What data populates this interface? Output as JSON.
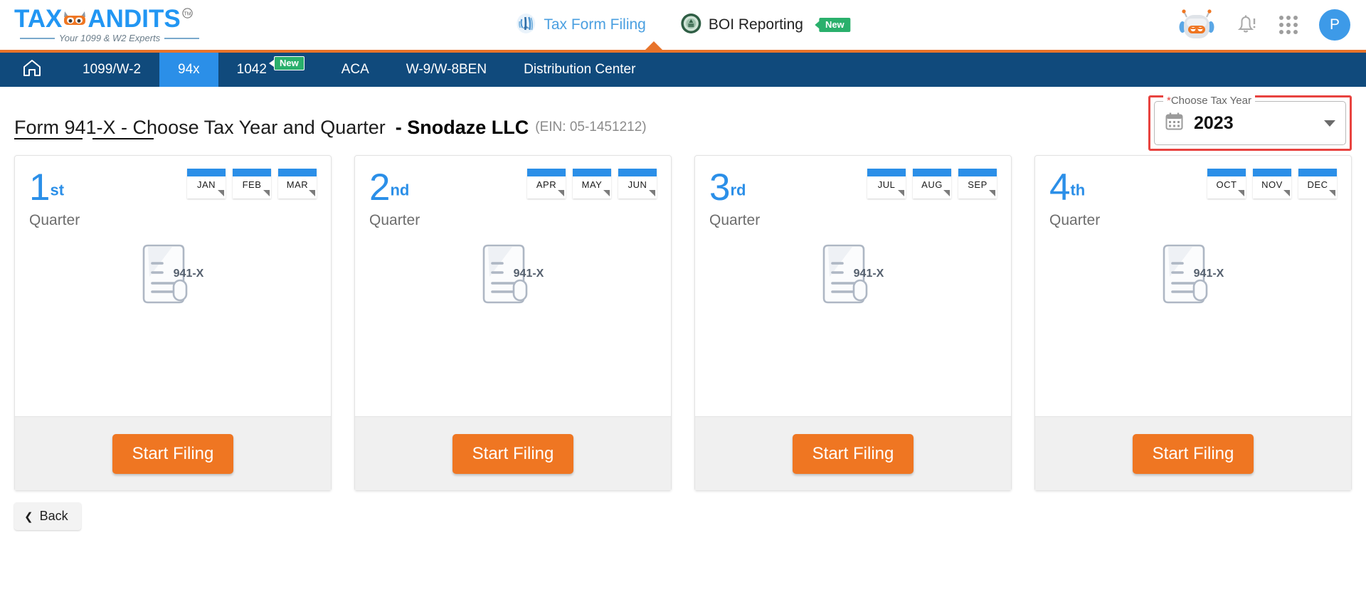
{
  "brand": {
    "logo_text_left": "TAX",
    "logo_text_right": "ANDITS",
    "logo_tm": "TM",
    "tagline": "Your 1099 & W2 Experts",
    "mask_icon": "bandit-mask-icon"
  },
  "header": {
    "center_items": [
      {
        "label": "Tax Form Filing",
        "icon": "irs-logo-icon",
        "active": true,
        "badge": null
      },
      {
        "label": "BOI Reporting",
        "icon": "fincen-seal-icon",
        "active": false,
        "badge": "New"
      }
    ],
    "right_icons": [
      {
        "name": "chat-bot-icon"
      },
      {
        "name": "notification-bell-icon"
      },
      {
        "name": "apps-grid-icon"
      }
    ],
    "avatar_initial": "P"
  },
  "nav": {
    "home_icon": "home-icon",
    "items": [
      {
        "label": "1099/W-2",
        "active": false,
        "badge": null
      },
      {
        "label": "94x",
        "active": true,
        "badge": null
      },
      {
        "label": "1042",
        "active": false,
        "badge": "New"
      },
      {
        "label": "ACA",
        "active": false,
        "badge": null
      },
      {
        "label": "W-9/W-8BEN",
        "active": false,
        "badge": null
      },
      {
        "label": "Distribution Center",
        "active": false,
        "badge": null
      }
    ]
  },
  "page": {
    "title": "Form 941-X - Choose Tax Year and Quarter",
    "company": "- Snodaze LLC",
    "ein": "(EIN: 05-1451212)"
  },
  "tax_year": {
    "legend_required": "*",
    "legend": "Choose Tax Year",
    "value": "2023",
    "calendar_icon": "calendar-icon",
    "caret_icon": "chevron-down-icon",
    "highlight_color": "#e8433f"
  },
  "quarters": [
    {
      "number": "1",
      "ordinal": "st",
      "sub": "Quarter",
      "months": [
        "JAN",
        "FEB",
        "MAR"
      ],
      "doc_label": "941-X",
      "doc_icon": "document-941x-icon",
      "button": "Start Filing"
    },
    {
      "number": "2",
      "ordinal": "nd",
      "sub": "Quarter",
      "months": [
        "APR",
        "MAY",
        "JUN"
      ],
      "doc_label": "941-X",
      "doc_icon": "document-941x-icon",
      "button": "Start Filing"
    },
    {
      "number": "3",
      "ordinal": "rd",
      "sub": "Quarter",
      "months": [
        "JUL",
        "AUG",
        "SEP"
      ],
      "doc_label": "941-X",
      "doc_icon": "document-941x-icon",
      "button": "Start Filing"
    },
    {
      "number": "4",
      "ordinal": "th",
      "sub": "Quarter",
      "months": [
        "OCT",
        "NOV",
        "DEC"
      ],
      "doc_label": "941-X",
      "doc_icon": "document-941x-icon",
      "button": "Start Filing"
    }
  ],
  "footer": {
    "back_label": "Back",
    "back_icon": "chevron-left-icon"
  },
  "colors": {
    "nav_blue": "#104a7c",
    "active_blue": "#2b8fe8",
    "orange": "#e8732a",
    "button_orange": "#ef7622",
    "green_badge": "#2ab06c"
  }
}
